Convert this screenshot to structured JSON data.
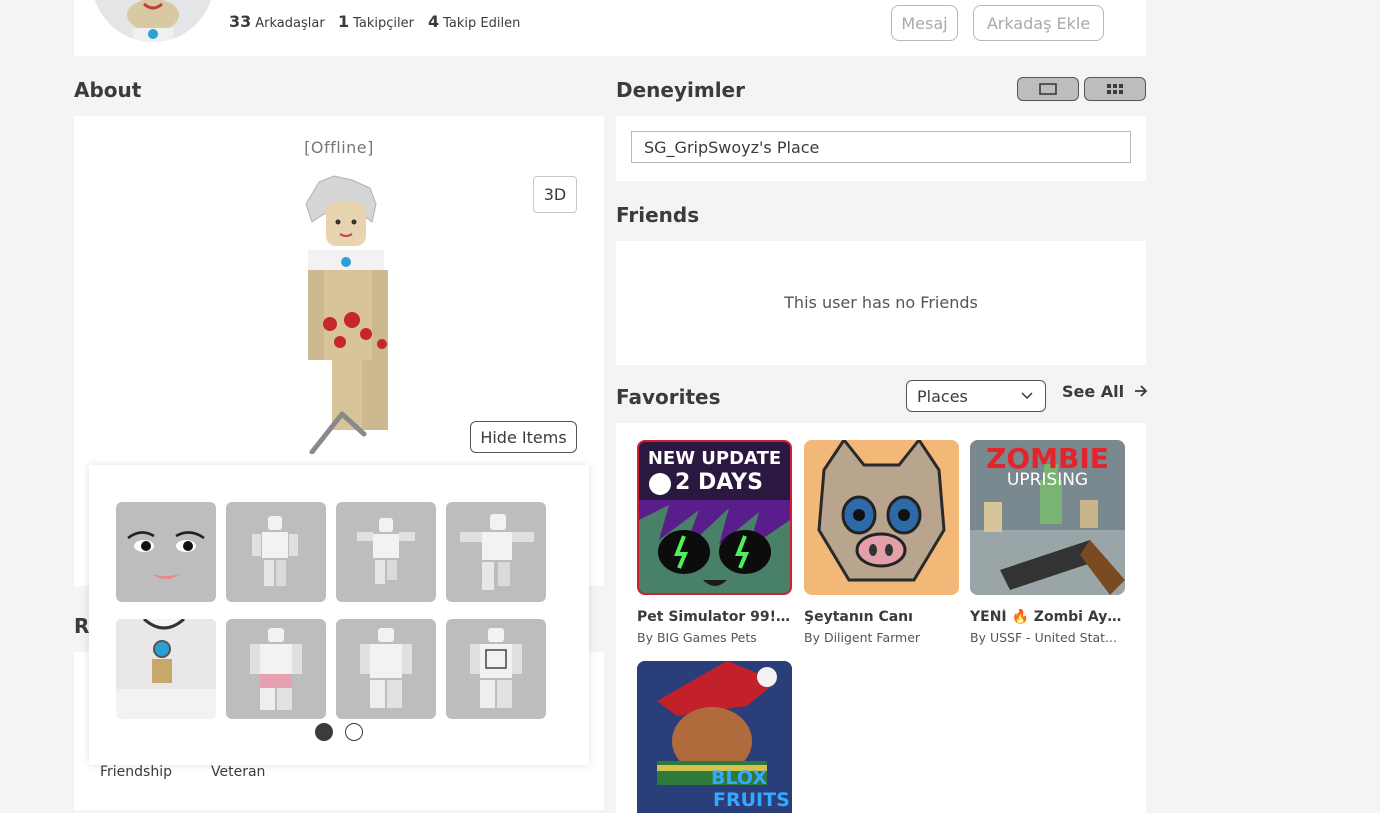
{
  "header": {
    "stats": [
      {
        "count": "33",
        "label": "Arkadaşlar"
      },
      {
        "count": "1",
        "label": "Takipçiler"
      },
      {
        "count": "4",
        "label": "Takip Edilen"
      }
    ],
    "message_button": "Mesaj",
    "add_friend_button": "Arkadaş Ekle"
  },
  "about": {
    "title": "About",
    "status": "[Offline]",
    "btn_3d": "3D",
    "hide_items": "Hide Items",
    "items_page_count": 2,
    "items_current_page": 1,
    "hidden_title_fragment": "R",
    "badges": [
      "Friendship",
      "Veteran"
    ]
  },
  "experiences": {
    "title": "Deneyimler",
    "selected_place": "SG_GripSwoyz's Place"
  },
  "friends": {
    "title": "Friends",
    "empty_text": "This user has no Friends"
  },
  "favorites": {
    "title": "Favorites",
    "filter_value": "Places",
    "see_all": "See All",
    "games": [
      {
        "name": "Pet Simulator 99! (...",
        "creator": "By BIG Games Pets",
        "thumb_text_1": "NEW UPDATE",
        "thumb_text_2": "2 DAYS"
      },
      {
        "name": "Şeytanın Canı",
        "creator": "By Diligent Farmer"
      },
      {
        "name": "YENİ 🔥 Zombi Aya...",
        "creator": "By USSF - United Stat...",
        "thumb_text_1": "ZOMBIE",
        "thumb_text_2": "UPRISING"
      },
      {
        "name": "",
        "creator": "",
        "thumb_text_1": "BLOX",
        "thumb_text_2": "FRUITS"
      }
    ]
  },
  "colors": {
    "page_bg": "#f2f4f5",
    "panel_bg": "#ffffff",
    "text": "#393b3d",
    "tile_bg": "#bdbdbd"
  }
}
